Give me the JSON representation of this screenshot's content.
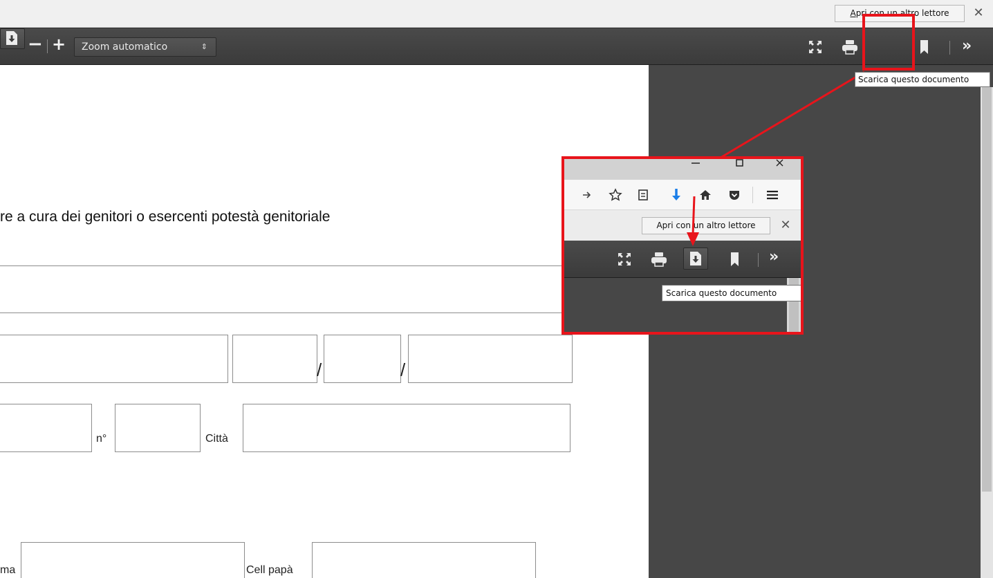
{
  "notification": {
    "open_with_label": "Apri con un altro lettore",
    "close_glyph": "✕"
  },
  "toolbar": {
    "zoom_out_glyph": "−",
    "zoom_in_glyph": "+",
    "zoom_value": "Zoom automatico",
    "zoom_arrows_glyph": "⇕",
    "more_glyph": "»",
    "icons": [
      "fullscreen-icon",
      "print-icon",
      "download-icon",
      "bookmark-icon"
    ]
  },
  "tooltip": {
    "download_text": "Scarica questo documento"
  },
  "document": {
    "heading": "re a cura dei genitori o esercenti  potestà  genitoriale",
    "date_separator_1": "/",
    "date_separator_2": "/",
    "label_number": "n°",
    "label_city": "Città",
    "label_cell_mom": "ma",
    "label_cell_dad": "Cell papà"
  },
  "inset": {
    "navbar_icons": [
      "arrow-right-icon",
      "star-icon",
      "reading-list-icon",
      "download-arrow-icon",
      "home-icon",
      "pocket-icon",
      "menu-icon"
    ],
    "open_with_label": "Apri con un altro lettore",
    "close_glyph": "✕",
    "tooltip_text": "Scarica questo documento",
    "more_glyph": "»"
  },
  "colors": {
    "highlight": "#e8141b",
    "toolbar_bg": "#444444",
    "download_arrow_blue": "#1a7ee8"
  }
}
